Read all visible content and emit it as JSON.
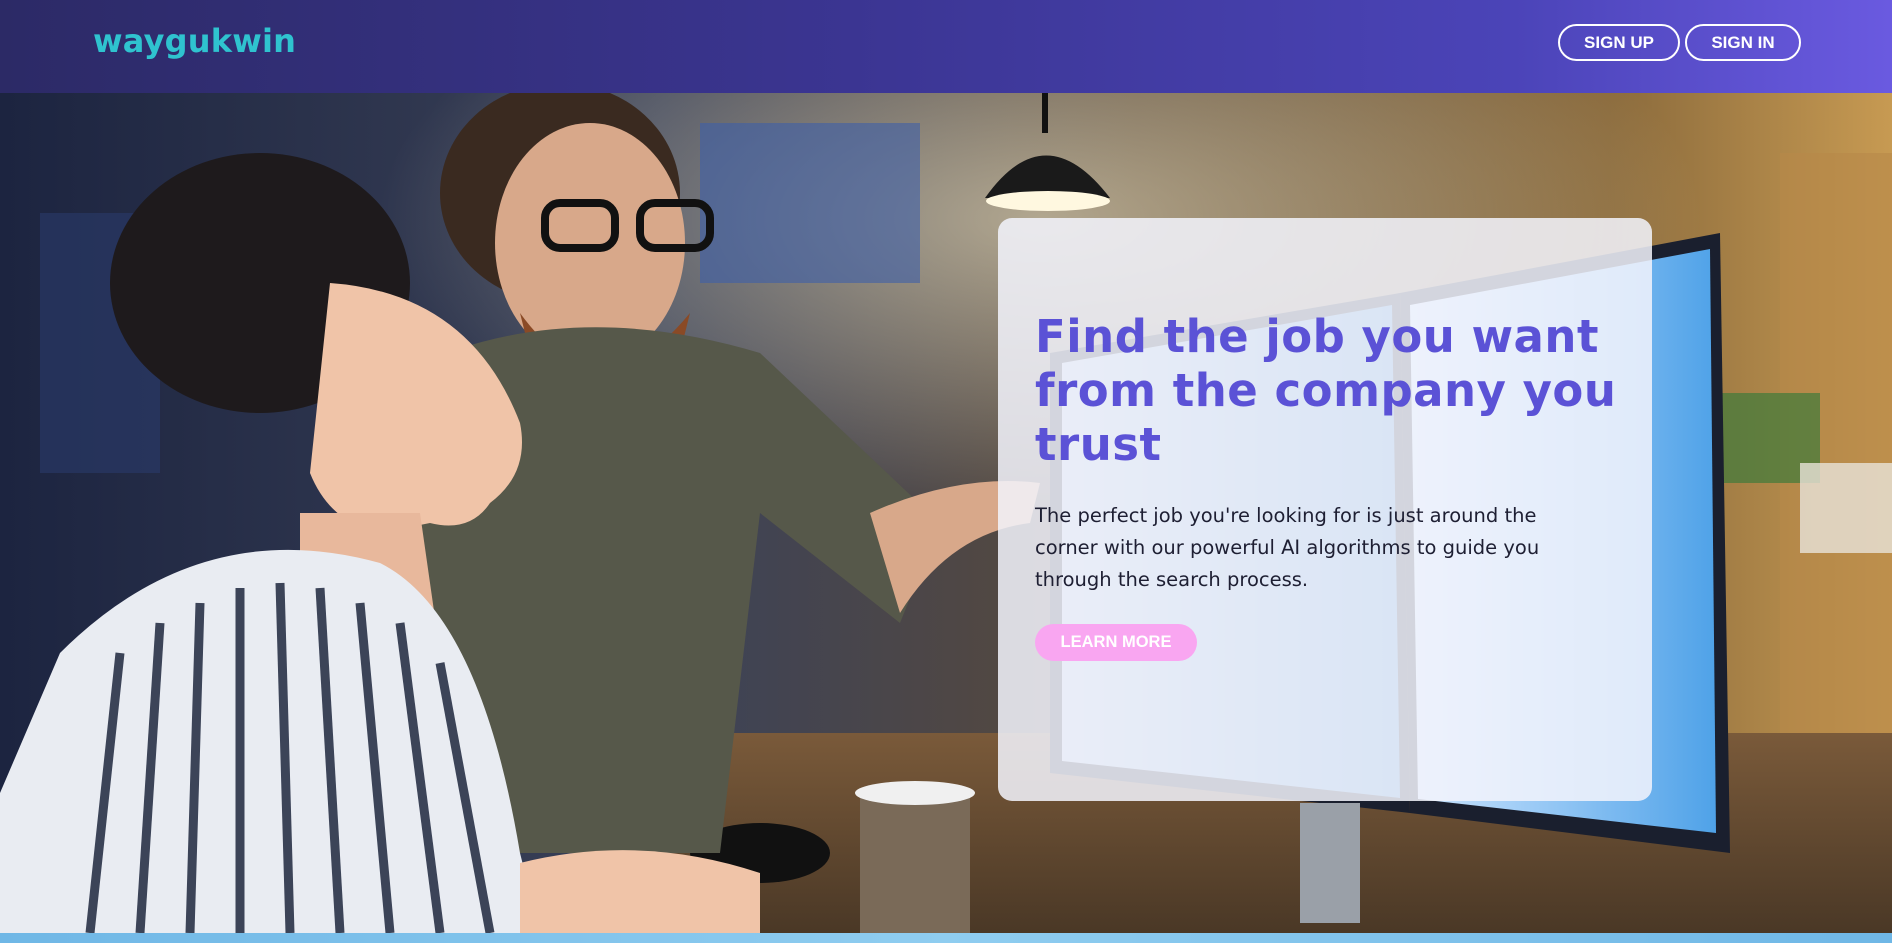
{
  "header": {
    "logo": "waygukwin",
    "signup_label": "SIGN UP",
    "signin_label": "SIGN IN"
  },
  "hero": {
    "headline": "Find the job you want from the company you trust",
    "subtext": "The perfect job you're looking for is just around the corner with our powerful AI algorithms to guide you through the search process.",
    "cta_label": "LEARN MORE"
  },
  "colors": {
    "brand_teal": "#2fc3cf",
    "headline_purple": "#5b52d6",
    "cta_pink": "#f9a6f1",
    "header_start": "#2c2a66",
    "header_end": "#6a5ae0"
  },
  "images": {
    "hero_background": "photo-two-people-at-computer-office"
  }
}
